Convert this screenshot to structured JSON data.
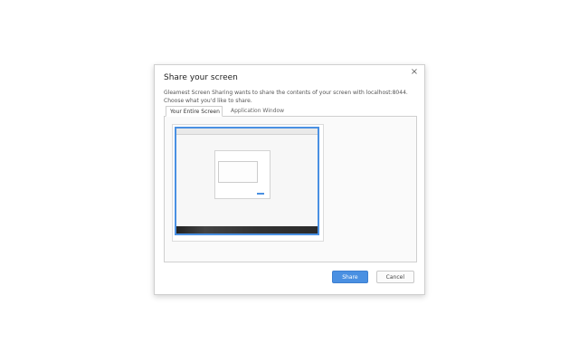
{
  "dialog": {
    "title": "Share your screen",
    "close_icon": "×",
    "description": "Gleamest Screen Sharing wants to share the contents of your screen with localhost:8044. Choose what you'd like to share.",
    "tabs": [
      {
        "label": "Your Entire Screen",
        "active": true
      },
      {
        "label": "Application Window",
        "active": false
      }
    ],
    "buttons": {
      "share": "Share",
      "cancel": "Cancel"
    }
  },
  "colors": {
    "accent": "#4a90e2",
    "border": "#cfcfcf",
    "text": "#222222",
    "muted_text": "#555555"
  },
  "icons": {
    "close": "close-icon"
  }
}
